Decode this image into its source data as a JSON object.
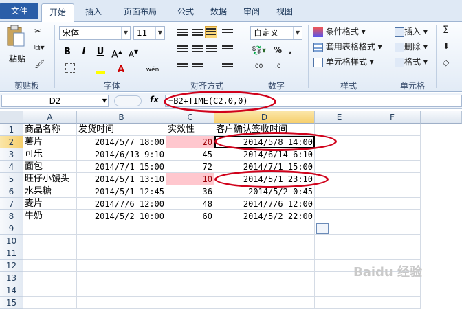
{
  "tabs": [
    "文件",
    "开始",
    "插入",
    "页面布局",
    "公式",
    "数据",
    "审阅",
    "视图"
  ],
  "ribbon": {
    "clipboard": {
      "paste": "粘贴",
      "label": "剪贴板"
    },
    "font": {
      "name": "宋体",
      "size": "11",
      "bold": "B",
      "italic": "I",
      "underline": "U",
      "label": "字体",
      "wen": "wén"
    },
    "alignment": {
      "label": "对齐方式"
    },
    "number": {
      "format": "自定义",
      "label": "数字"
    },
    "styles": {
      "cond": "条件格式",
      "table": "套用表格格式",
      "cell": "单元格样式",
      "label": "样式"
    },
    "cells": {
      "insert": "插入",
      "delete": "删除",
      "format": "格式",
      "label": "单元格"
    },
    "sigma": "Σ"
  },
  "formula_bar": {
    "name_box": "D2",
    "fx": "fx",
    "formula": "=B2+TIME(C2,0,0)"
  },
  "columns": [
    "A",
    "B",
    "C",
    "D",
    "E",
    "F"
  ],
  "rows": [
    {
      "n": "1",
      "a": "商品名称",
      "b": "发货时间",
      "c": "实效性",
      "d": "客户确认签收时间",
      "pink": false
    },
    {
      "n": "2",
      "a": "薯片",
      "b": "2014/5/7 18:00",
      "c": "20",
      "d": "2014/5/8 14:00",
      "pink": true
    },
    {
      "n": "3",
      "a": "可乐",
      "b": "2014/6/13 9:10",
      "c": "45",
      "d": "2014/6/14 6:10",
      "pink": false
    },
    {
      "n": "4",
      "a": "面包",
      "b": "2014/7/1 15:00",
      "c": "72",
      "d": "2014/7/1 15:00",
      "pink": false
    },
    {
      "n": "5",
      "a": "旺仔小馒头",
      "b": "2014/5/1 13:10",
      "c": "10",
      "d": "2014/5/1 23:10",
      "pink": true
    },
    {
      "n": "6",
      "a": "水果糖",
      "b": "2014/5/1 12:45",
      "c": "36",
      "d": "2014/5/2 0:45",
      "pink": false
    },
    {
      "n": "7",
      "a": "麦片",
      "b": "2014/7/6 12:00",
      "c": "48",
      "d": "2014/7/6 12:00",
      "pink": false
    },
    {
      "n": "8",
      "a": "牛奶",
      "b": "2014/5/2 10:00",
      "c": "60",
      "d": "2014/5/2 22:00",
      "pink": false
    },
    {
      "n": "9"
    },
    {
      "n": "10"
    },
    {
      "n": "11"
    },
    {
      "n": "12"
    },
    {
      "n": "13"
    },
    {
      "n": "14"
    },
    {
      "n": "15"
    }
  ],
  "selected_cell": "D2",
  "colors": {
    "highlight_fill": "#ffc7ce",
    "highlight_text": "#9c0006",
    "annotation": "#d0021b",
    "file_tab": "#2a5ea8"
  },
  "watermark": "Baidu 经验"
}
